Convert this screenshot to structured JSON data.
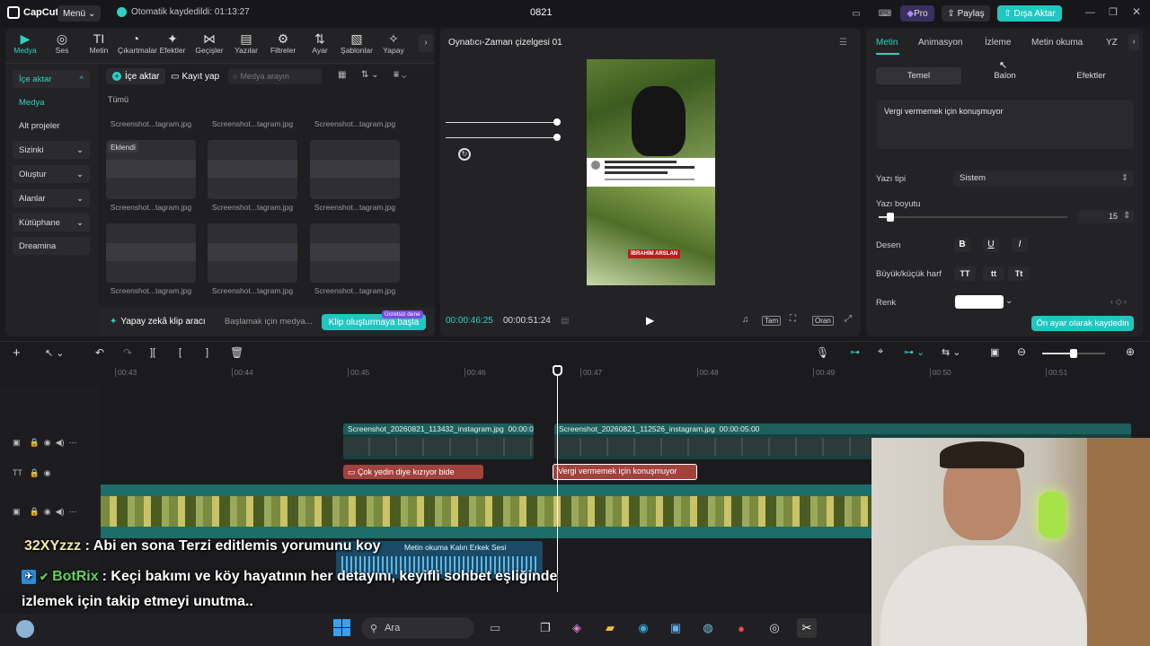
{
  "app": {
    "name": "CapCut",
    "menu": "Menü",
    "autosave": "Otomatik kaydedildi: 01:13:27",
    "project_title": "0821",
    "pro_label": "Pro",
    "share_label": "Paylaş",
    "export_label": "Dışa Aktar"
  },
  "toolbar": {
    "items": [
      {
        "label": "Medya",
        "icon": "media-icon"
      },
      {
        "label": "Ses",
        "icon": "audio-icon"
      },
      {
        "label": "Metin",
        "icon": "text-icon"
      },
      {
        "label": "Çıkartmalar",
        "icon": "sticker-icon"
      },
      {
        "label": "Efektler",
        "icon": "effects-icon"
      },
      {
        "label": "Geçişler",
        "icon": "transitions-icon"
      },
      {
        "label": "Yazılar",
        "icon": "captions-icon"
      },
      {
        "label": "Filtreler",
        "icon": "filters-icon"
      },
      {
        "label": "Ayar",
        "icon": "adjust-icon"
      },
      {
        "label": "Şablonlar",
        "icon": "templates-icon"
      },
      {
        "label": "Yapay",
        "icon": "ai-icon"
      }
    ]
  },
  "sidebar": {
    "items": [
      {
        "label": "İçe aktar",
        "chevron": "^"
      },
      {
        "label": "Medya",
        "chevron": ""
      },
      {
        "label": "Alt projeler",
        "chevron": ""
      },
      {
        "label": "Sizinki",
        "chevron": "⌄"
      },
      {
        "label": "Oluştur",
        "chevron": "⌄"
      },
      {
        "label": "Alanlar",
        "chevron": "⌄"
      },
      {
        "label": "Kütüphane",
        "chevron": "⌄"
      },
      {
        "label": "Dreamina",
        "chevron": ""
      }
    ]
  },
  "media": {
    "import_btn": "İçe aktar",
    "record_btn": "Kayıt yap",
    "search_placeholder": "Medya arayın",
    "filter_all": "Tümü",
    "added_badge": "Eklendi",
    "thumb_label": "Screenshot...tagram.jpg",
    "ai_clip_label": "Yapay zekâ klip aracı",
    "ai_start_text": "Başlamak için medya...",
    "ai_create_btn": "Klip oluşturmaya başla",
    "free_trial_badge": "Ücretsiz dene"
  },
  "player": {
    "title": "Oynatıcı-Zaman çizelgesi 01",
    "current_time": "00:00:46:25",
    "total_time": "00:00:51:24",
    "full_btn": "Tam",
    "ratio_btn": "Oran",
    "overlay_caption": "Vergi vermemek için konuşmuyor",
    "overlay_sticker": "İBRAHİM ARSLAN"
  },
  "inspector": {
    "tabs": [
      "Metin",
      "Animasyon",
      "İzleme",
      "Metin okuma",
      "YZ"
    ],
    "subtabs": [
      "Temel",
      "Balon",
      "Efektler"
    ],
    "text_value": "Vergi vermemek için konuşmuyor",
    "font_label": "Yazı tipi",
    "font_value": "Sistem",
    "size_label": "Yazı boyutu",
    "size_value": "15",
    "size_level": 0.06,
    "pattern_label": "Desen",
    "case_label": "Büyük/küçük harf",
    "case_opts": [
      "TT",
      "tt",
      "Tt"
    ],
    "color_label": "Renk",
    "color_value": "#ffffff",
    "save_default_btn": "Ön ayar olarak kaydedin"
  },
  "timeline": {
    "ruler_labels": [
      "00:43",
      "00:44",
      "00:45",
      "00:46",
      "00:47",
      "00:48",
      "00:49",
      "00:50",
      "00:51"
    ],
    "clip1_name": "Screenshot_20260821_113432_instagram.jpg",
    "clip1_dur": "00:00:0",
    "clip2_name": "Screenshot_20260821_112526_instagram.jpg",
    "clip2_dur": "00:00:05:00",
    "text1": "Çok yedin diye kızıyor bide",
    "text2": "Vergi vermemek için konuşmuyor",
    "audio_label": "Metin okuma Kalın Erkek Sesi",
    "zoom_level": 0.5
  },
  "chat": {
    "msg1_user": "32XYzzz",
    "msg1_text": ": Abi en sona Terzi editlemis yorumunu koy",
    "msg2_user": "BotRix",
    "msg2_text": ": Keçi bakımı ve köy hayatının her detayını, keyifli sohbet eşliğinde",
    "msg3_text": "izlemek için takip etmeyi unutma.."
  },
  "taskbar": {
    "search": "Ara"
  }
}
